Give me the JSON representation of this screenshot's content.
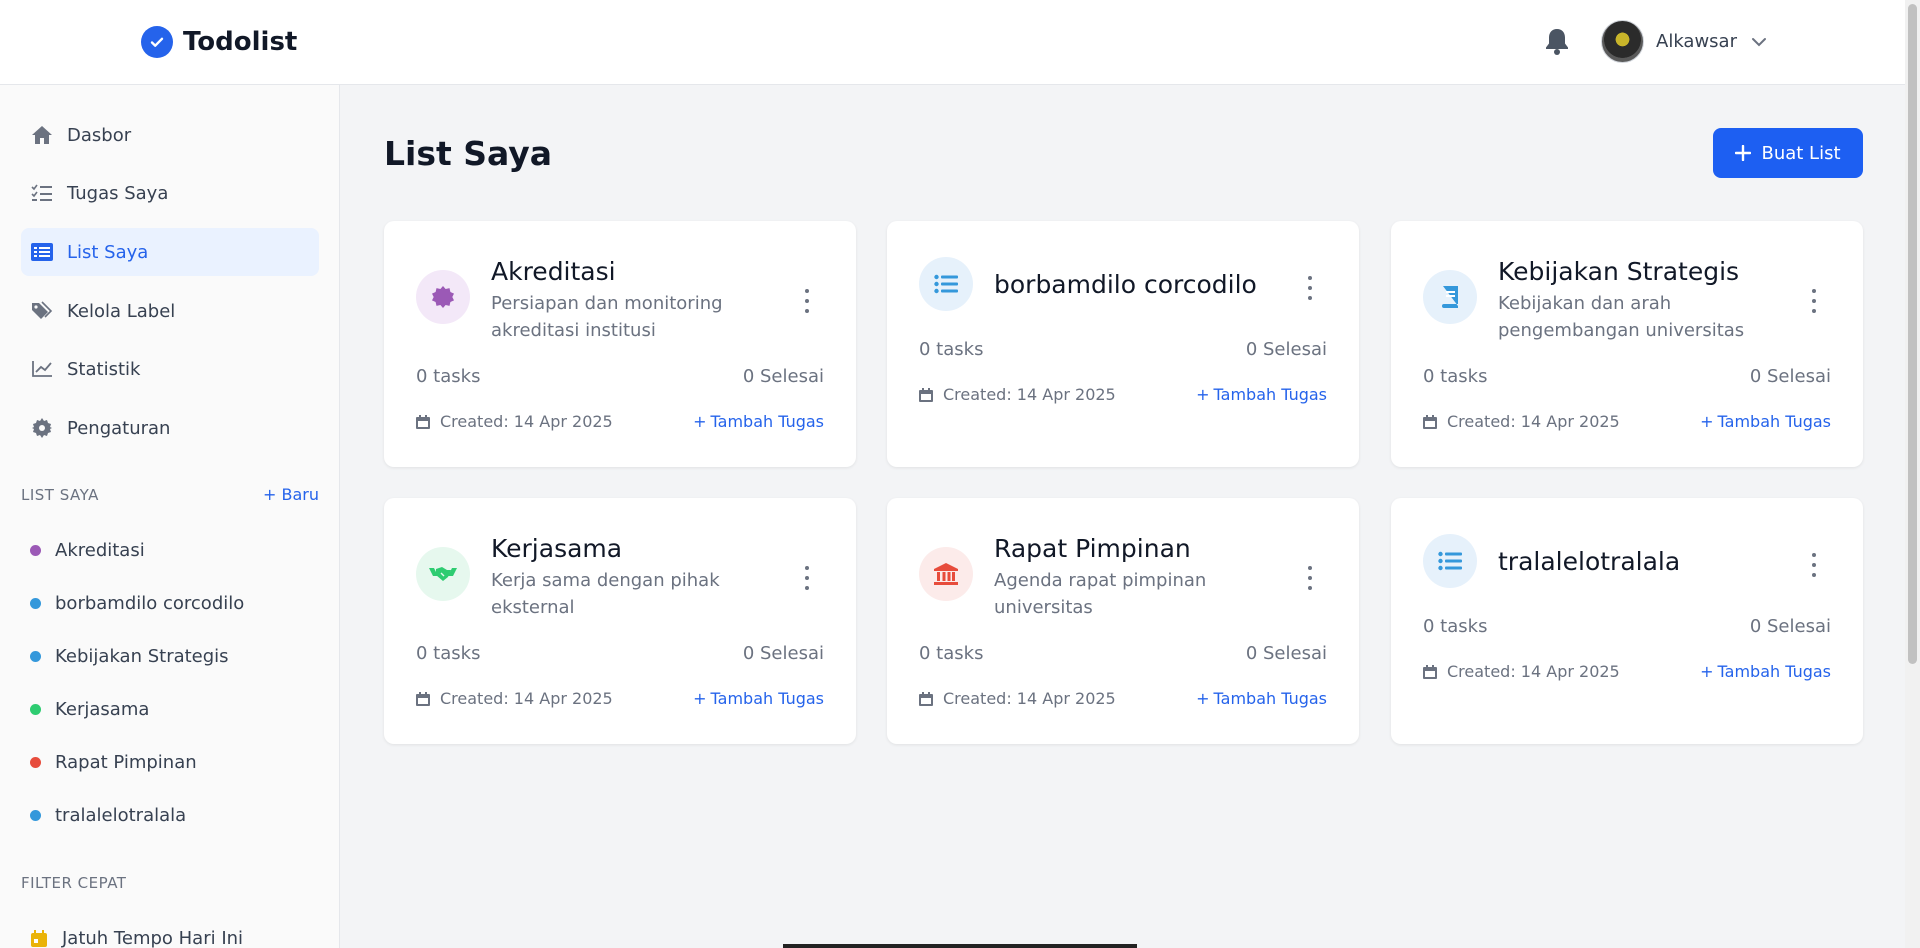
{
  "app": {
    "title": "Todolist"
  },
  "user": {
    "name": "Alkawsar"
  },
  "nav": [
    {
      "label": "Dasbor",
      "icon": "home-icon"
    },
    {
      "label": "Tugas Saya",
      "icon": "task-list-icon"
    },
    {
      "label": "List Saya",
      "icon": "list-icon",
      "active": true
    },
    {
      "label": "Kelola Label",
      "icon": "tags-icon"
    },
    {
      "label": "Statistik",
      "icon": "chart-icon"
    },
    {
      "label": "Pengaturan",
      "icon": "gear-icon"
    }
  ],
  "sidebar_lists": {
    "title": "LIST SAYA",
    "new_label": "Baru",
    "items": [
      {
        "label": "Akreditasi",
        "color": "#9b59b6"
      },
      {
        "label": "borbamdilo corcodilo",
        "color": "#3498db"
      },
      {
        "label": "Kebijakan Strategis",
        "color": "#3498db"
      },
      {
        "label": "Kerjasama",
        "color": "#2ecc71"
      },
      {
        "label": "Rapat Pimpinan",
        "color": "#e74c3c"
      },
      {
        "label": "tralalelotralala",
        "color": "#3498db"
      }
    ]
  },
  "quick_filter": {
    "title": "FILTER CEPAT",
    "items": [
      {
        "label": "Jatuh Tempo Hari Ini",
        "icon": "calendar-icon"
      }
    ]
  },
  "main": {
    "title": "List Saya",
    "create_label": "Buat List"
  },
  "cards": [
    {
      "title": "Akreditasi",
      "desc": "Persiapan dan monitoring akreditasi institusi",
      "tasks": "0 tasks",
      "done": "0 Selesai",
      "created": "Created: 14 Apr 2025",
      "add": "Tambah Tugas",
      "icon": "certificate-icon",
      "color": "#9b59b6",
      "bg": "#f3e8f8"
    },
    {
      "title": "borbamdilo corcodilo",
      "desc": "",
      "tasks": "0 tasks",
      "done": "0 Selesai",
      "created": "Created: 14 Apr 2025",
      "add": "Tambah Tugas",
      "icon": "list-icon",
      "color": "#3498db",
      "bg": "#e6f1fb"
    },
    {
      "title": "Kebijakan Strategis",
      "desc": "Kebijakan dan arah pengembangan universitas",
      "tasks": "0 tasks",
      "done": "0 Selesai",
      "created": "Created: 14 Apr 2025",
      "add": "Tambah Tugas",
      "icon": "book-icon",
      "color": "#3498db",
      "bg": "#e6f1fb"
    },
    {
      "title": "Kerjasama",
      "desc": "Kerja sama dengan pihak eksternal",
      "tasks": "0 tasks",
      "done": "0 Selesai",
      "created": "Created: 14 Apr 2025",
      "add": "Tambah Tugas",
      "icon": "handshake-icon",
      "color": "#2ecc71",
      "bg": "#e6f8ee"
    },
    {
      "title": "Rapat Pimpinan",
      "desc": "Agenda rapat pimpinan universitas",
      "tasks": "0 tasks",
      "done": "0 Selesai",
      "created": "Created: 14 Apr 2025",
      "add": "Tambah Tugas",
      "icon": "institution-icon",
      "color": "#e74c3c",
      "bg": "#fcebea"
    },
    {
      "title": "tralalelotralala",
      "desc": "",
      "tasks": "0 tasks",
      "done": "0 Selesai",
      "created": "Created: 14 Apr 2025",
      "add": "Tambah Tugas",
      "icon": "list-icon",
      "color": "#3498db",
      "bg": "#e6f1fb"
    }
  ]
}
